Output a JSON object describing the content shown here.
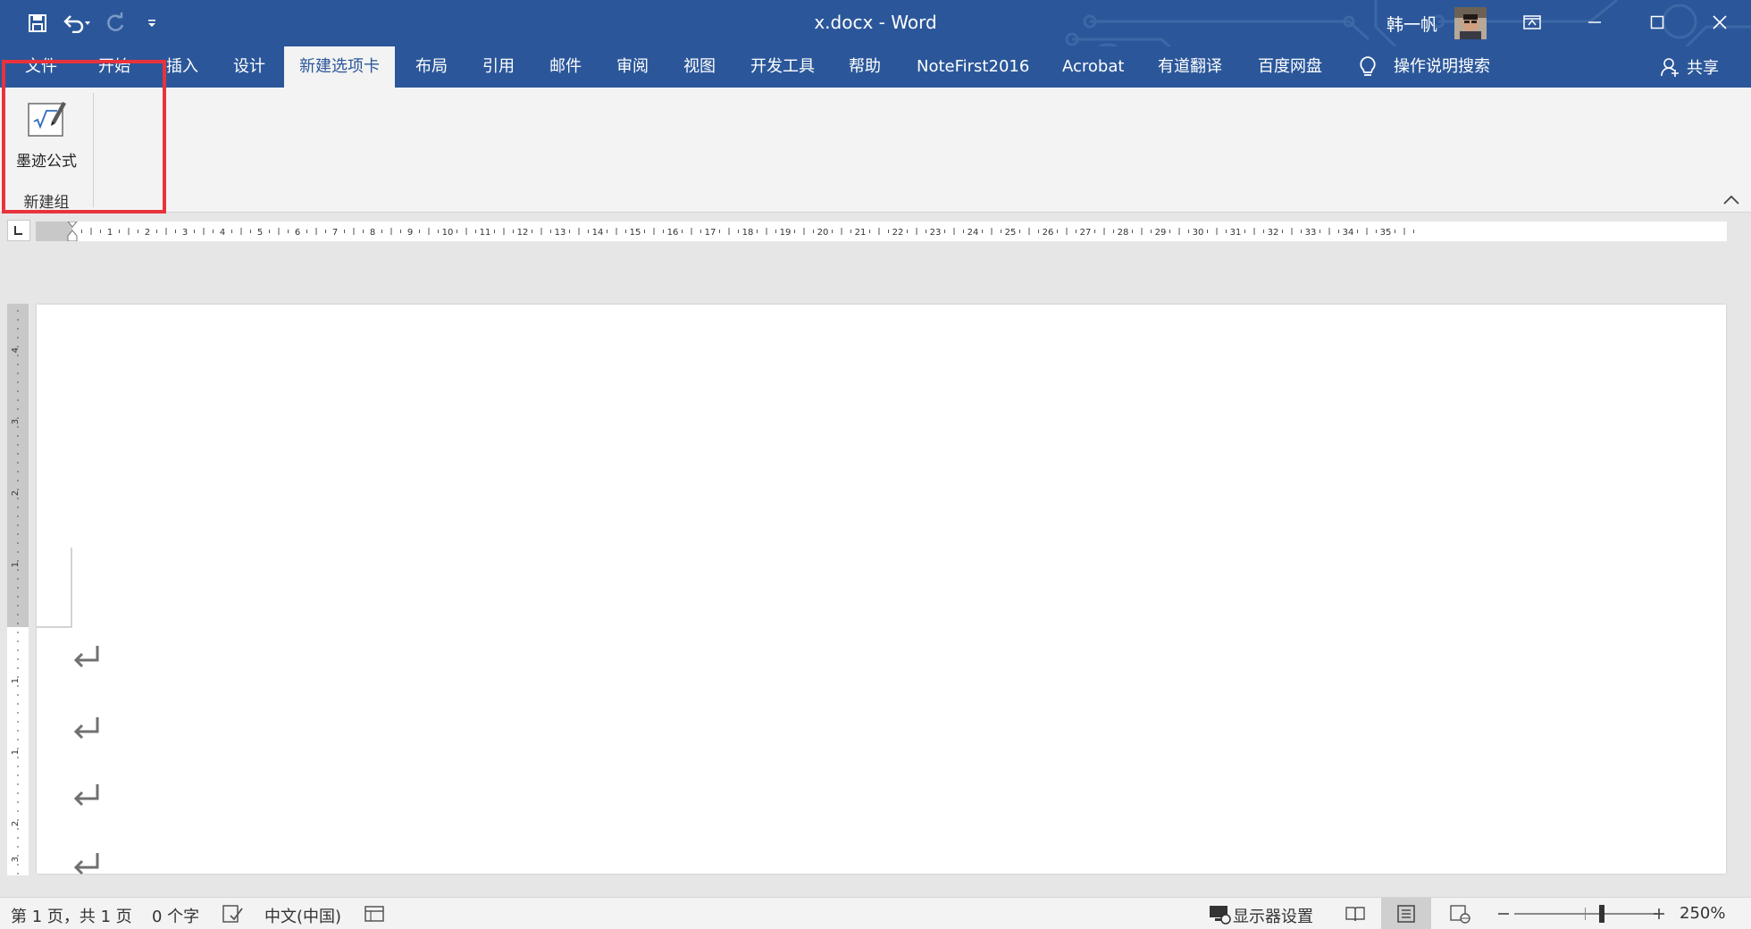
{
  "window": {
    "title": "x.docx  -  Word",
    "user_name": "韩一帆",
    "quick_access": [
      "save-icon",
      "undo-icon",
      "redo-icon",
      "customize-icon"
    ],
    "controls": [
      "ribbon-display-options-icon",
      "minimize-icon",
      "maximize-icon",
      "close-icon"
    ]
  },
  "tabs": [
    {
      "label": "文件",
      "active": false
    },
    {
      "label": "开始",
      "active": false
    },
    {
      "label": "插入",
      "active": false
    },
    {
      "label": "设计",
      "active": false
    },
    {
      "label": "新建选项卡",
      "active": true
    },
    {
      "label": "布局",
      "active": false
    },
    {
      "label": "引用",
      "active": false
    },
    {
      "label": "邮件",
      "active": false
    },
    {
      "label": "审阅",
      "active": false
    },
    {
      "label": "视图",
      "active": false
    },
    {
      "label": "开发工具",
      "active": false
    },
    {
      "label": "帮助",
      "active": false
    },
    {
      "label": "NoteFirst2016",
      "active": false
    },
    {
      "label": "Acrobat",
      "active": false
    },
    {
      "label": "有道翻译",
      "active": false
    },
    {
      "label": "百度网盘",
      "active": false
    },
    {
      "label": "操作说明搜索",
      "active": false
    }
  ],
  "share_label": "共享",
  "ribbon": {
    "ink_equation_label": "墨迹公式",
    "group_label": "新建组"
  },
  "ruler": {
    "labels": [
      "1",
      "2",
      "3",
      "4",
      "5",
      "6",
      "7",
      "8",
      "9",
      "10",
      "11",
      "12",
      "13",
      "14",
      "15",
      "16",
      "17",
      "18",
      "19",
      "20",
      "21",
      "22",
      "23",
      "24",
      "25",
      "26",
      "27",
      "28",
      "29",
      "30",
      "31",
      "32",
      "33",
      "34",
      "35"
    ],
    "vertical_labels": [
      "4",
      "3",
      "2",
      "1",
      "1",
      "1",
      "2",
      "3"
    ]
  },
  "status": {
    "page": "第 1 页，共 1 页",
    "words": "0 个字",
    "language": "中文(中国)",
    "display_settings": "显示器设置",
    "zoom": "250%"
  },
  "colors": {
    "accent": "#2b579a",
    "highlight": "#e8333c"
  }
}
